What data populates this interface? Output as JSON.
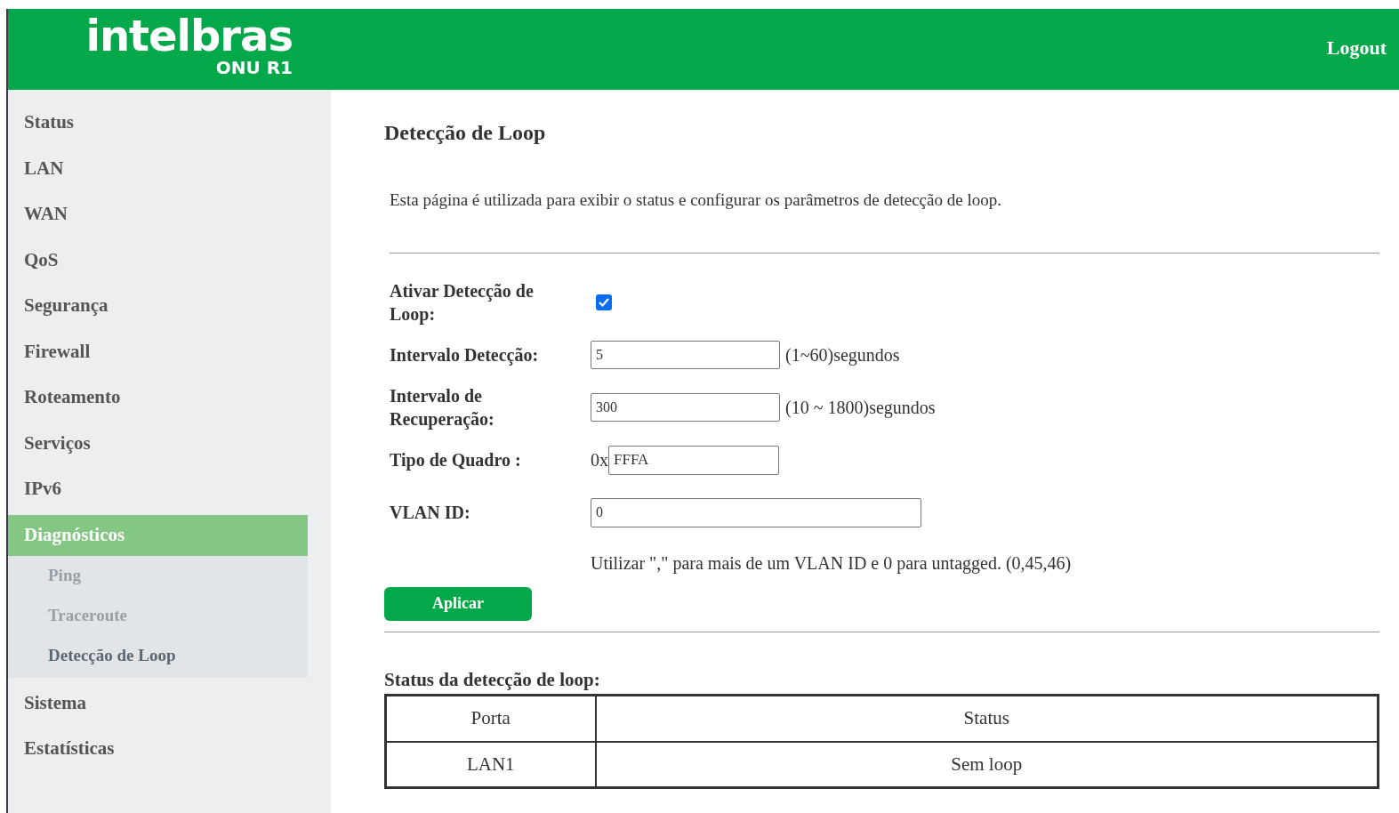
{
  "header": {
    "logo": "intelbras",
    "model": "ONU R1",
    "logout": "Logout"
  },
  "sidebar": {
    "items": [
      {
        "label": "Status",
        "selected": false
      },
      {
        "label": "LAN",
        "selected": false
      },
      {
        "label": "WAN",
        "selected": false
      },
      {
        "label": "QoS",
        "selected": false
      },
      {
        "label": "Segurança",
        "selected": false
      },
      {
        "label": "Firewall",
        "selected": false
      },
      {
        "label": "Roteamento",
        "selected": false
      },
      {
        "label": "Serviços",
        "selected": false
      },
      {
        "label": "IPv6",
        "selected": false
      },
      {
        "label": "Diagnósticos",
        "selected": true,
        "children": [
          {
            "label": "Ping",
            "selected": false
          },
          {
            "label": "Traceroute",
            "selected": false
          },
          {
            "label": "Detecção de Loop",
            "selected": true
          }
        ]
      },
      {
        "label": "Sistema",
        "selected": false
      },
      {
        "label": "Estatísticas",
        "selected": false
      }
    ]
  },
  "main": {
    "title": "Detecção de Loop",
    "description": "Esta página é utilizada para exibir o status e configurar os parâmetros de detecção de loop.",
    "form": {
      "fields": [
        {
          "kind": "checkbox",
          "label": "Ativar Detecção de Loop:",
          "checked": true
        },
        {
          "kind": "text",
          "label": "Intervalo Detecção:",
          "value": "5",
          "hint": "(1~60)segundos"
        },
        {
          "kind": "text",
          "label": "Intervalo de Recuperação:",
          "value": "300",
          "hint": "(10 ~ 1800)segundos"
        },
        {
          "kind": "prefixed",
          "label": "Tipo de Quadro :",
          "prefix": "0x",
          "value": "FFFA"
        },
        {
          "kind": "wide",
          "label": "VLAN ID:",
          "value": "0"
        }
      ],
      "note": "Utilizar \",\" para mais de um VLAN ID e 0 para untagged. (0,45,46)",
      "apply": "Aplicar"
    },
    "status_title": "Status da detecção de loop:",
    "table": {
      "columns": [
        "Porta",
        "Status"
      ],
      "rows": [
        [
          "LAN1",
          "Sem loop"
        ]
      ]
    }
  }
}
